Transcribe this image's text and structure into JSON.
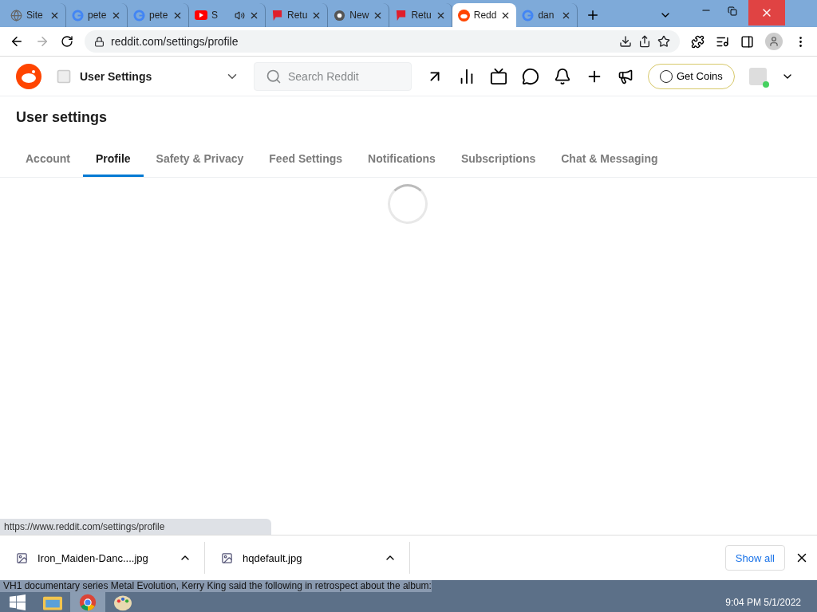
{
  "browser_tabs": [
    {
      "title": "Site",
      "kind": "globe",
      "selected": false,
      "audio": false
    },
    {
      "title": "pete",
      "kind": "google",
      "selected": false,
      "audio": false
    },
    {
      "title": "pete",
      "kind": "google",
      "selected": false,
      "audio": false
    },
    {
      "title": "S",
      "kind": "video",
      "selected": false,
      "audio": true
    },
    {
      "title": "Retu",
      "kind": "flag",
      "selected": false,
      "audio": false
    },
    {
      "title": "New",
      "kind": "chrome",
      "selected": false,
      "audio": false
    },
    {
      "title": "Retu",
      "kind": "flag",
      "selected": false,
      "audio": false
    },
    {
      "title": "Redd",
      "kind": "reddit",
      "selected": true,
      "audio": false
    },
    {
      "title": "dan",
      "kind": "google",
      "selected": false,
      "audio": false
    }
  ],
  "address_bar": {
    "url": "reddit.com/settings/profile"
  },
  "header": {
    "community": "User Settings",
    "search": {
      "placeholder": "Search Reddit"
    },
    "coins_button": "Get Coins"
  },
  "page": {
    "title": "User settings",
    "tabs": [
      {
        "label": "Account",
        "selected": false
      },
      {
        "label": "Profile",
        "selected": true
      },
      {
        "label": "Safety & Privacy",
        "selected": false
      },
      {
        "label": "Feed Settings",
        "selected": false
      },
      {
        "label": "Notifications",
        "selected": false
      },
      {
        "label": "Subscriptions",
        "selected": false
      },
      {
        "label": "Chat & Messaging",
        "selected": false
      }
    ],
    "loading": true
  },
  "status_bubble": "https://www.reddit.com/settings/profile",
  "downloads": {
    "items": [
      "Iron_Maiden-Danc....jpg",
      "hqdefault.jpg"
    ],
    "show_all": "Show all"
  },
  "taskbar": {
    "background_lines": [
      "VH1 documentary series Metal Evolution, Kerry King said the following in retrospect about the album:"
    ],
    "time": "9:04 PM",
    "date": "5/1/2022"
  }
}
